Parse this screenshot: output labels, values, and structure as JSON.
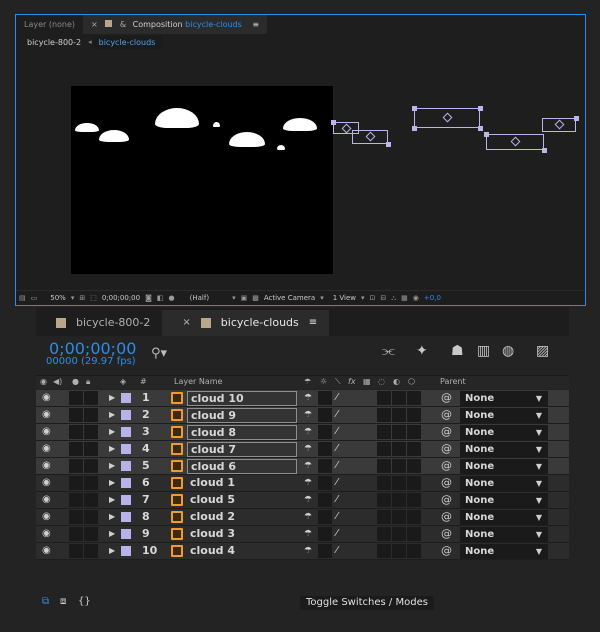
{
  "viewer": {
    "tabs": [
      {
        "label": "Layer (none)"
      },
      {
        "prefix": "Composition",
        "name": "bicycle-clouds",
        "menu": "≡"
      }
    ],
    "breadcrumbs": [
      "bicycle-800-2",
      "bicycle-clouds"
    ],
    "footer": {
      "zoom": "50%",
      "timecode": "0;00;00;00",
      "resolution": "(Half)",
      "camera": "Active Camera",
      "views": "1 View",
      "exposure": "+0,0"
    }
  },
  "timeline": {
    "tabs": [
      {
        "label": "bicycle-800-2"
      },
      {
        "label": "bicycle-clouds",
        "menu": "≡"
      }
    ],
    "timecode": "0;00;00;00",
    "frames": "00000 (29.97 fps)",
    "columns": {
      "number": "#",
      "layer_name": "Layer Name",
      "parent": "Parent"
    },
    "layers": [
      {
        "num": "1",
        "name": "cloud 10",
        "parent": "None",
        "selected": true
      },
      {
        "num": "2",
        "name": "cloud 9",
        "parent": "None",
        "selected": true
      },
      {
        "num": "3",
        "name": "cloud 8",
        "parent": "None",
        "selected": true
      },
      {
        "num": "4",
        "name": "cloud 7",
        "parent": "None",
        "selected": true
      },
      {
        "num": "5",
        "name": "cloud 6",
        "parent": "None",
        "selected": true
      },
      {
        "num": "6",
        "name": "cloud 1",
        "parent": "None",
        "selected": false
      },
      {
        "num": "7",
        "name": "cloud 5",
        "parent": "None",
        "selected": false
      },
      {
        "num": "8",
        "name": "cloud 2",
        "parent": "None",
        "selected": false
      },
      {
        "num": "9",
        "name": "cloud 3",
        "parent": "None",
        "selected": false
      },
      {
        "num": "10",
        "name": "cloud 4",
        "parent": "None",
        "selected": false
      }
    ],
    "toggle_label": "Toggle Switches / Modes"
  },
  "colors": {
    "accent": "#2d8ceb",
    "label_lavender": "#b5b3ea",
    "ai_icon": "#f29a2e"
  }
}
